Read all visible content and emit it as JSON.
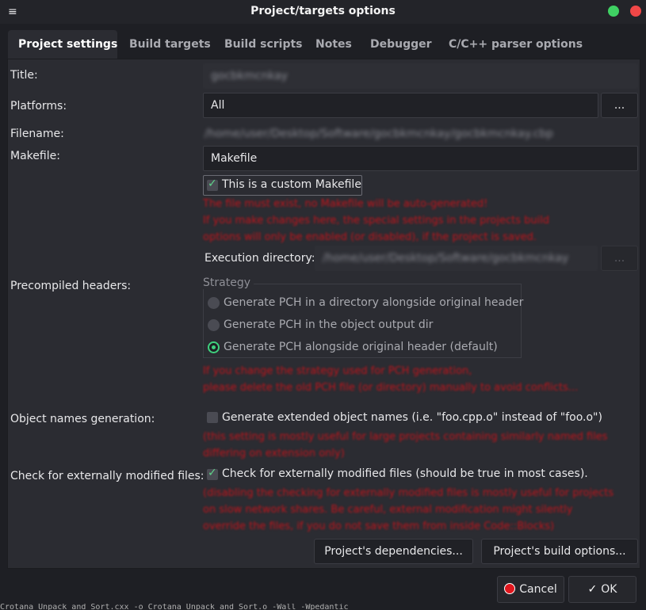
{
  "window": {
    "title": "Project/targets options",
    "menu_icon": "hamburger-icon"
  },
  "tabs": [
    {
      "label": "Project settings",
      "active": true
    },
    {
      "label": "Build targets"
    },
    {
      "label": "Build scripts"
    },
    {
      "label": "Notes"
    },
    {
      "label": "Debugger"
    },
    {
      "label": "C/C++ parser options"
    }
  ],
  "labels": {
    "title": "Title:",
    "platforms": "Platforms:",
    "filename": "Filename:",
    "makefile": "Makefile:",
    "exec_dir": "Execution directory:",
    "pch": "Precompiled headers:",
    "objnames": "Object names generation:",
    "extmod": "Check for externally modified files:"
  },
  "fields": {
    "title_value": "gocbkmcnkay",
    "platforms_value": "All",
    "platforms_button": "...",
    "filename_value": "/home/user/Desktop/Software/gocbkmcnkay/gocbkmcnkay.cbp",
    "makefile_value": "Makefile",
    "exec_dir_value": "/home/user/Desktop/Software/gocbkmcnkay",
    "exec_dir_button": "..."
  },
  "custom_makefile": {
    "label": "This is a custom Makefile",
    "checked": true
  },
  "makefile_warning": [
    "The file must exist, no Makefile will be auto-generated!",
    "If you make changes here, the special settings in the projects build",
    "options will only be enabled (or disabled), if the project is saved."
  ],
  "strategy": {
    "title": "Strategy",
    "options": [
      "Generate PCH in a directory alongside original header",
      "Generate PCH in the object output dir",
      "Generate PCH alongside original header (default)"
    ],
    "selected_index": 2
  },
  "pch_warning": [
    "If you change the strategy used for PCH generation,",
    "please delete the old PCH file (or directory) manually to avoid conflicts..."
  ],
  "objnames": {
    "label": "Generate extended object names (i.e. \"foo.cpp.o\" instead of \"foo.o\")",
    "checked": false,
    "note": [
      "(this setting is mostly useful for large projects containing similarly named files",
      "differing on extension only)"
    ]
  },
  "extmod": {
    "label": "Check for externally modified files (should be true in most cases).",
    "checked": true,
    "note": [
      "(disabling the checking for externally modified files is mostly useful for projects",
      "on slow network shares. Be careful, external modification might silently",
      "override the files, if you do not save them from inside Code::Blocks)"
    ]
  },
  "buttons": {
    "dependencies": "Project's dependencies...",
    "build_options": "Project's build options...",
    "cancel": "Cancel",
    "ok": "OK"
  },
  "status_line": "Crotana Unpack and Sort.cxx  -o Crotana Unpack and Sort.o  -Wall  -Wpedantic",
  "colors": {
    "background": "#1e1f24",
    "panel": "#2b2c32",
    "warning_text": "#c0141b",
    "accent_green": "#3fd17e",
    "close_red": "#f04747"
  }
}
